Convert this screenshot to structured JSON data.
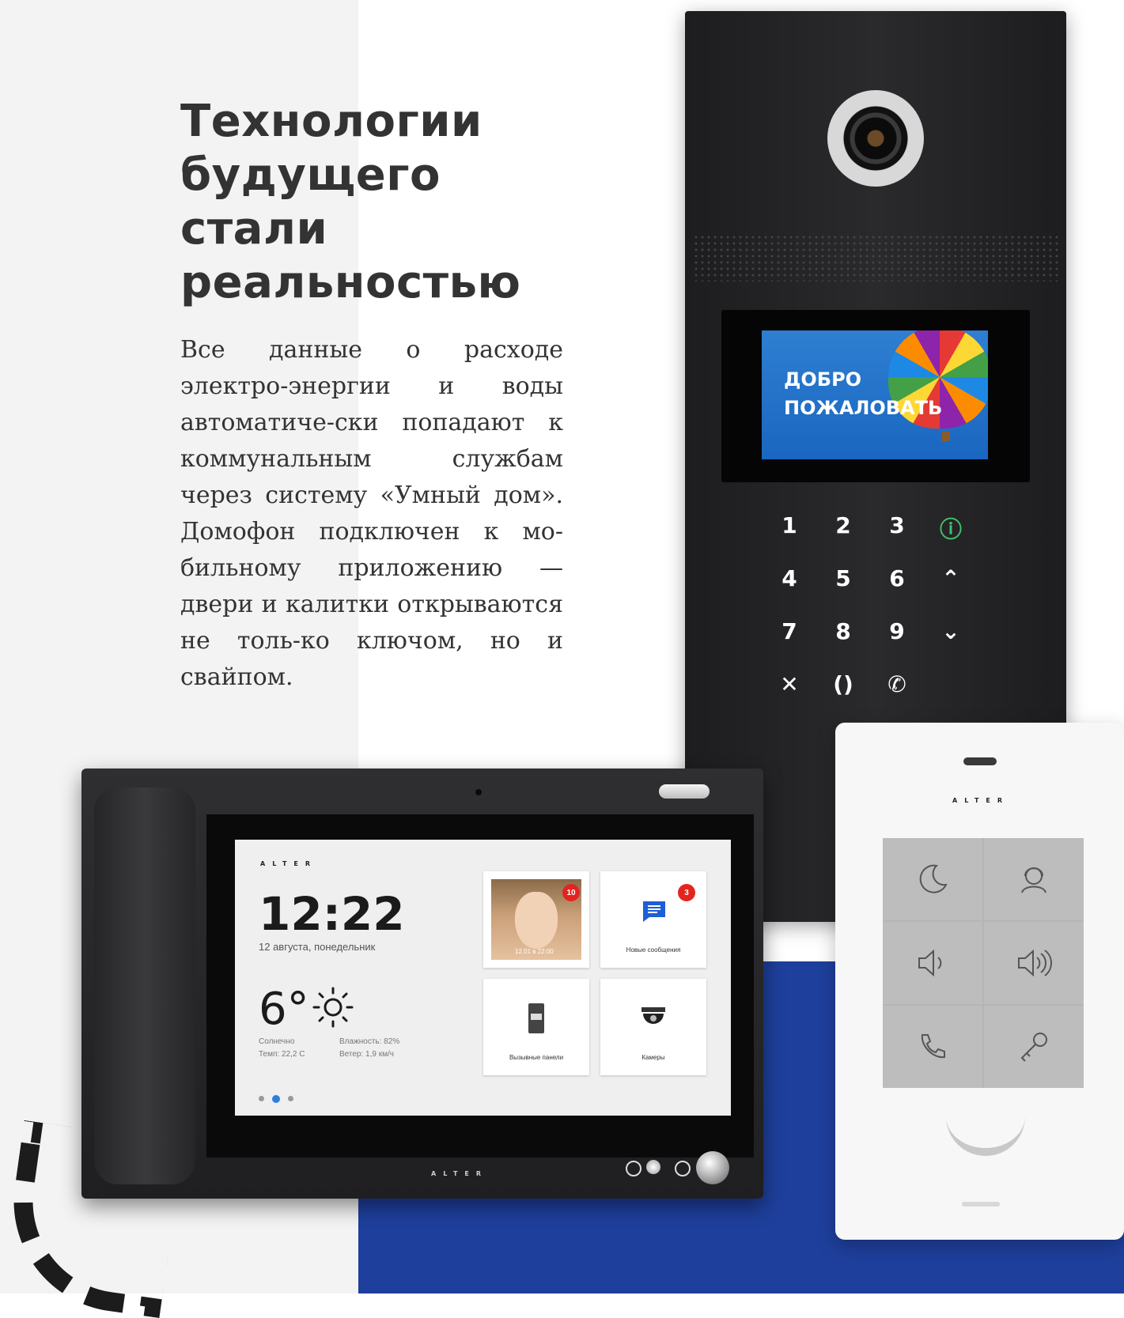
{
  "hero": {
    "title": "Технологии будущего стали реальностью",
    "body": "Все данные о расходе электро-энергии и воды автоматиче-ски попадают к коммунальным службам через систему «Умный дом». Домофон подключен к мо-бильному приложению — двери и калитки открываются не толь-ко ключом, но и свайпом."
  },
  "door_panel": {
    "screen_text": "ДОБРО ПОЖАЛОВАТЬ",
    "keypad": [
      "1",
      "2",
      "3",
      "ⓘ",
      "4",
      "5",
      "6",
      "⌃",
      "7",
      "8",
      "9",
      "⌄",
      "✕",
      "()",
      "✆",
      ""
    ]
  },
  "monitor": {
    "brand": "ALTER",
    "time": "12:22",
    "date": "12 августа, понедельник",
    "temperature": "6°",
    "weather": {
      "condition": "Солнечно",
      "temp_line": "Темп: 22,2 С",
      "humidity": "Влажность: 82%",
      "wind": "Ветер: 1,9 км/ч"
    },
    "tiles": [
      {
        "label": "",
        "badge": "10",
        "photo_stamp": "12.01 в 22:00"
      },
      {
        "label": "Новые сообщения",
        "badge": "3"
      },
      {
        "label": "Вызывные панели",
        "badge": ""
      },
      {
        "label": "Камеры",
        "badge": ""
      }
    ],
    "bottom_brand": "ALTER"
  },
  "handheld": {
    "brand": "ALTER",
    "keys": [
      "moon-icon",
      "operator-icon",
      "volume-low-icon",
      "volume-high-icon",
      "call-icon",
      "key-icon"
    ]
  },
  "colors": {
    "left_bg": "#f3f3f3",
    "blue_block": "#1e3f9c",
    "badge": "#e2251f",
    "accent": "#2e7ce0"
  }
}
